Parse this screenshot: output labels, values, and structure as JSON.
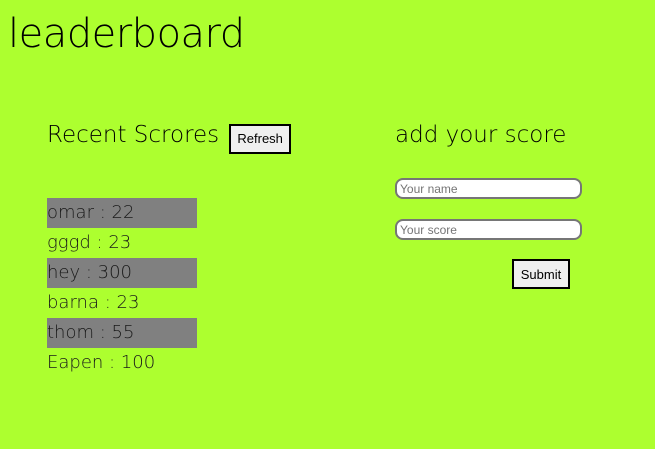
{
  "page": {
    "title": "leaderboard",
    "background_color": "#adff2f"
  },
  "recent_scores": {
    "heading": "Recent Scrores",
    "refresh_label": "Refresh",
    "stripe_color": "#808080",
    "items": [
      {
        "text": "omar : 22"
      },
      {
        "text": "gggd : 23"
      },
      {
        "text": "hey : 300"
      },
      {
        "text": "barna : 23"
      },
      {
        "text": "thom : 55"
      },
      {
        "text": "Eapen : 100"
      }
    ]
  },
  "add_score": {
    "heading": "add your score",
    "name_placeholder": "Your name",
    "score_placeholder": "Your score",
    "submit_label": "Submit"
  }
}
